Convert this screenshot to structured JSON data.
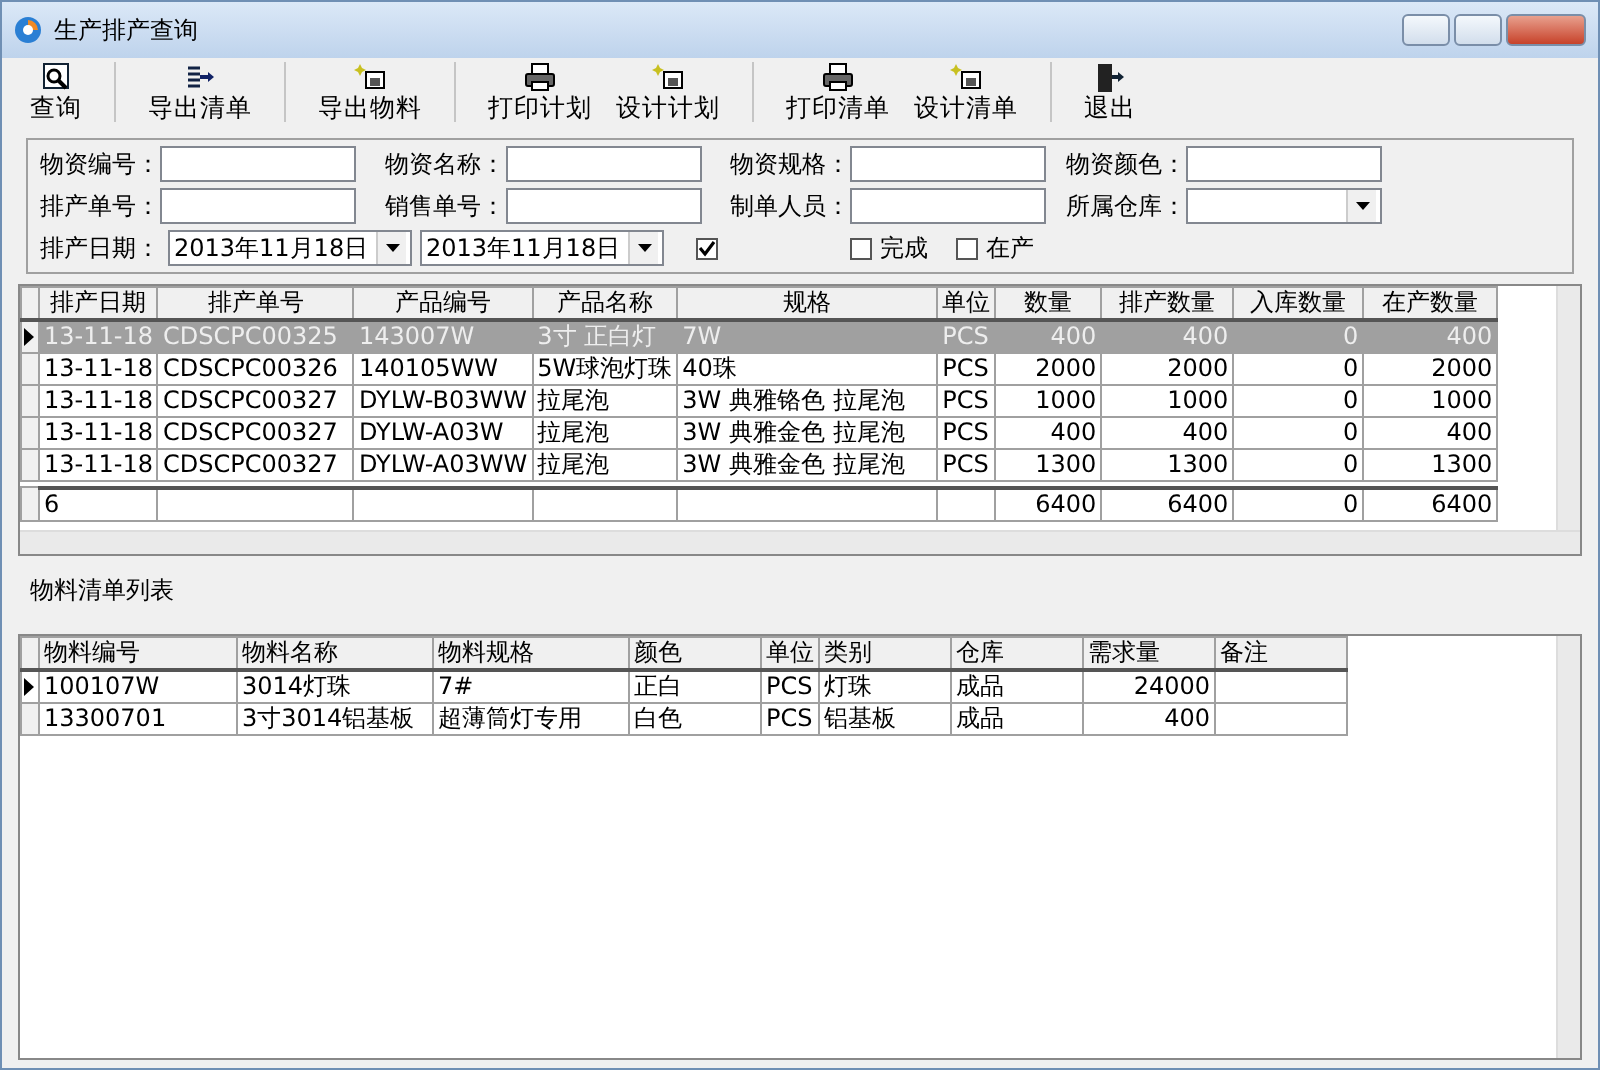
{
  "window": {
    "title": "生产排产查询"
  },
  "toolbar_groups": [
    [
      {
        "label": "查询",
        "kind": "search"
      }
    ],
    [
      {
        "label": "导出清单",
        "kind": "export"
      }
    ],
    [
      {
        "label": "导出物料",
        "kind": "design"
      }
    ],
    [
      {
        "label": "打印计划",
        "kind": "print"
      },
      {
        "label": "设计计划",
        "kind": "design"
      }
    ],
    [
      {
        "label": "打印清单",
        "kind": "print"
      },
      {
        "label": "设计清单",
        "kind": "design"
      }
    ],
    [
      {
        "label": "退出",
        "kind": "exit"
      }
    ]
  ],
  "filters": [
    {
      "label": "物资编号：",
      "kind": "text"
    },
    {
      "label": "物资名称：",
      "kind": "text"
    },
    {
      "label": "物资规格：",
      "kind": "text"
    },
    {
      "label": "物资颜色：",
      "kind": "text"
    },
    {
      "label": "排产单号：",
      "kind": "text"
    },
    {
      "label": "销售单号：",
      "kind": "text"
    },
    {
      "label": "制单人员：",
      "kind": "text"
    },
    {
      "label": "所属仓库：",
      "kind": "combo"
    }
  ],
  "date_filter": {
    "label": "排产日期：",
    "from": "2013年11月18日",
    "to": "2013年11月18日",
    "checked": true
  },
  "status_checks": [
    {
      "label": "完成",
      "checked": false
    },
    {
      "label": "在产",
      "checked": false
    }
  ],
  "plan_table": {
    "columns": [
      "排产日期",
      "排产单号",
      "产品编号",
      "产品名称",
      "规格",
      "单位",
      "数量",
      "排产数量",
      "入库数量",
      "在产数量"
    ],
    "rows": [
      {
        "selected": true,
        "cells": [
          "13-11-18",
          "CDSCPC00325",
          "143007W",
          "3寸 正白灯",
          "7W",
          "PCS",
          "400",
          "400",
          "0",
          "400"
        ]
      },
      {
        "selected": false,
        "cells": [
          "13-11-18",
          "CDSCPC00326",
          "140105WW",
          "5W球泡灯珠",
          "40珠",
          "PCS",
          "2000",
          "2000",
          "0",
          "2000"
        ]
      },
      {
        "selected": false,
        "cells": [
          "13-11-18",
          "CDSCPC00327",
          "DYLW-B03WW",
          "拉尾泡",
          "3W 典雅铬色 拉尾泡",
          "PCS",
          "1000",
          "1000",
          "0",
          "1000"
        ]
      },
      {
        "selected": false,
        "cells": [
          "13-11-18",
          "CDSCPC00327",
          "DYLW-A03W",
          "拉尾泡",
          "3W 典雅金色 拉尾泡",
          "PCS",
          "400",
          "400",
          "0",
          "400"
        ]
      },
      {
        "selected": false,
        "cells": [
          "13-11-18",
          "CDSCPC00327",
          "DYLW-A03WW",
          "拉尾泡",
          "3W 典雅金色 拉尾泡",
          "PCS",
          "1300",
          "1300",
          "0",
          "1300"
        ]
      }
    ],
    "totals": {
      "row_count": "6",
      "quantity": "6400",
      "planned": "6400",
      "stocked": "0",
      "in_production": "6400"
    }
  },
  "material_panel": {
    "title": "物料清单列表"
  },
  "material_table": {
    "columns": [
      "物料编号",
      "物料名称",
      "物料规格",
      "颜色",
      "单位",
      "类别",
      "仓库",
      "需求量",
      "备注"
    ],
    "rows": [
      {
        "selected": true,
        "cells": [
          "100107W",
          "3014灯珠",
          "7#",
          "正白",
          "PCS",
          "灯珠",
          "成品",
          "24000"
        ]
      },
      {
        "selected": false,
        "cells": [
          "13300701",
          "3寸3014铝基板",
          "超薄筒灯专用",
          "白色",
          "PCS",
          "铝基板",
          "成品",
          "400"
        ]
      }
    ]
  }
}
